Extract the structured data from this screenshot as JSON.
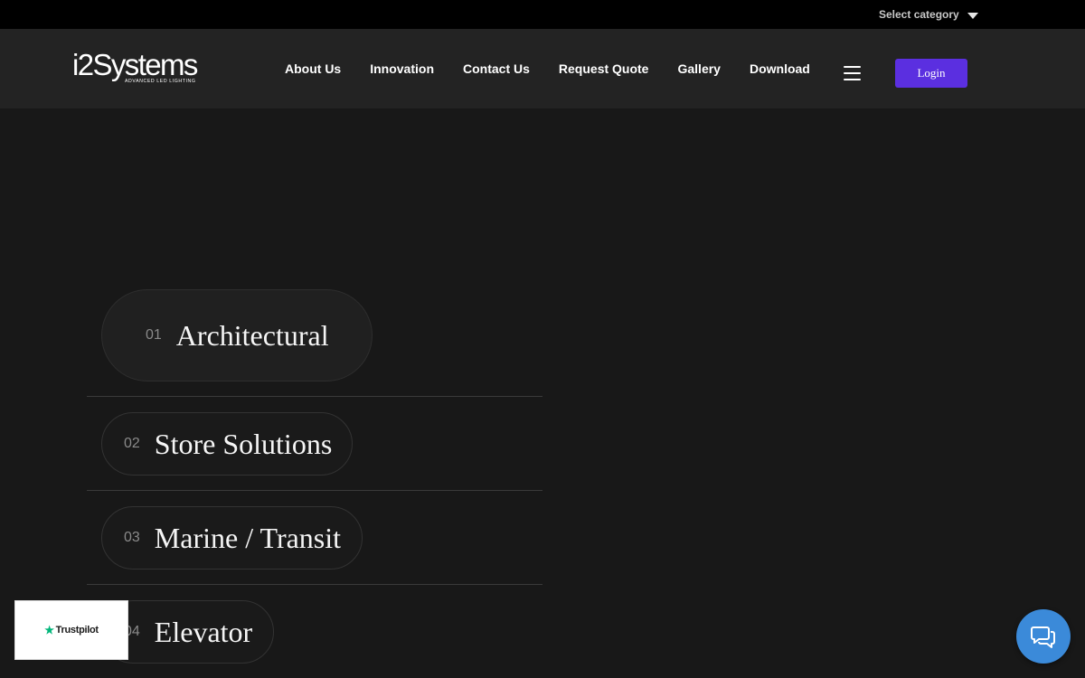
{
  "topbar": {
    "category_label": "Select category"
  },
  "brand": {
    "name": "i2Systems",
    "tagline": "ADVANCED LED LIGHTING"
  },
  "nav": {
    "items": [
      "About Us",
      "Innovation",
      "Contact Us",
      "Request Quote",
      "Gallery",
      "Download"
    ]
  },
  "header": {
    "login_label": "Login",
    "menu_icon": "hamburger-icon"
  },
  "categories": [
    {
      "num": "01",
      "label": "Architectural",
      "active": true
    },
    {
      "num": "02",
      "label": "Store Solutions",
      "active": false
    },
    {
      "num": "03",
      "label": "Marine / Transit",
      "active": false
    },
    {
      "num": "04",
      "label": "Elevator",
      "active": false
    }
  ],
  "widgets": {
    "trustpilot_label": "Trustpilot",
    "chat_icon": "chat-icon"
  },
  "colors": {
    "accent": "#5b2fe0",
    "chat": "#3b8ad9",
    "trustpilot_star": "#00b67a",
    "background": "#181818",
    "header": "#232323"
  }
}
